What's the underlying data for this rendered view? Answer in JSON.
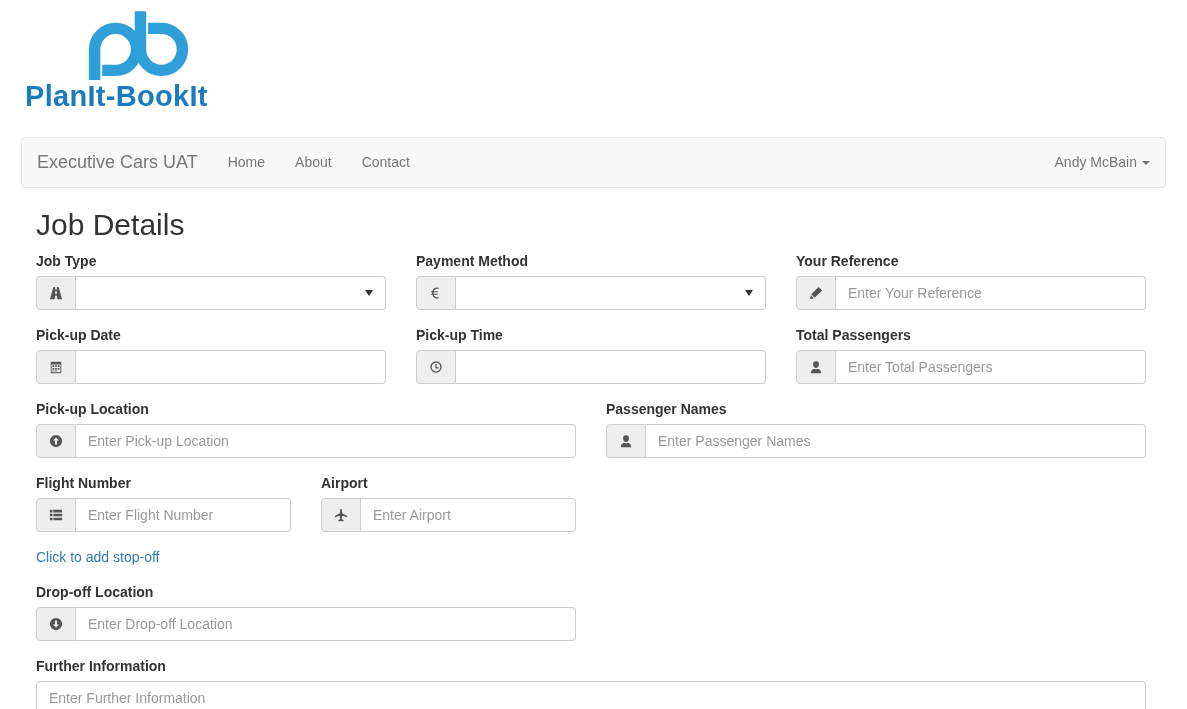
{
  "logo": {
    "text": "PlanIt-BookIt"
  },
  "navbar": {
    "brand": "Executive Cars UAT",
    "links": [
      "Home",
      "About",
      "Contact"
    ],
    "user": "Andy McBain"
  },
  "title": "Job Details",
  "rows": [
    {
      "fields": [
        {
          "kind": "select",
          "label": "Job Type"
        },
        {
          "kind": "select",
          "label": "Payment Method"
        },
        {
          "kind": "input",
          "label": "Your Reference",
          "placeholder": "Enter Your Reference"
        }
      ]
    },
    {
      "fields": [
        {
          "kind": "input",
          "label": "Pick-up Date"
        },
        {
          "kind": "input",
          "label": "Pick-up Time"
        },
        {
          "kind": "input",
          "label": "Total Passengers",
          "placeholder": "Enter Total Passengers"
        }
      ]
    },
    {
      "fields": [
        {
          "kind": "input",
          "label": "Pick-up Location",
          "placeholder": "Enter Pick-up Location"
        },
        {
          "kind": "input",
          "label": "Passenger Names",
          "placeholder": "Enter Passenger Names"
        }
      ]
    },
    {
      "fields": [
        {
          "kind": "input",
          "label": "Flight Number",
          "placeholder": "Enter Flight Number"
        },
        {
          "kind": "input",
          "label": "Airport",
          "placeholder": "Enter Airport"
        }
      ]
    }
  ],
  "stop_off_link": "Click to add stop-off",
  "drop_off": {
    "label": "Drop-off Location",
    "placeholder": "Enter Drop-off Location"
  },
  "further_info": {
    "label": "Further Information",
    "placeholder": "Enter Further Information"
  }
}
